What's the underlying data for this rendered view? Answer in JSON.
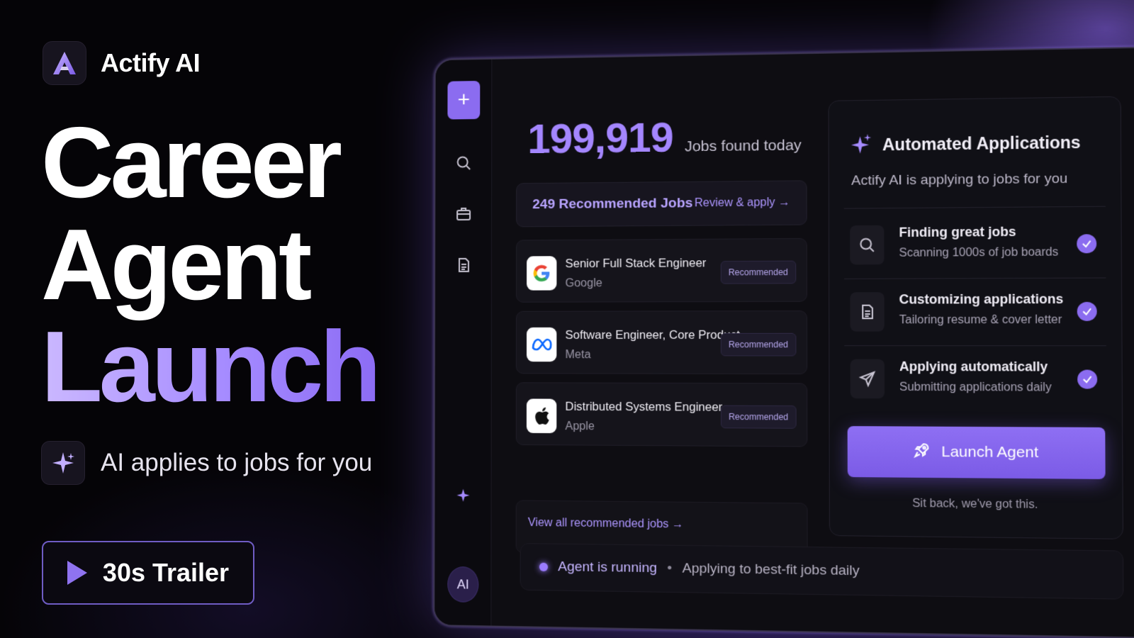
{
  "brand": {
    "name": "Actify AI",
    "logo_icon": "a-logo-icon"
  },
  "hero": {
    "line1": "Career",
    "line2": "Agent",
    "line3": "Launch",
    "tagline": "AI applies to jobs for you",
    "trailer_label": "30s Trailer"
  },
  "app": {
    "sidebar": {
      "avatar_label": "AI"
    },
    "stats": {
      "count": "199,919",
      "label": "Jobs found today"
    },
    "recommended": {
      "title": "249 Recommended Jobs",
      "link": "Review & apply →"
    },
    "jobs": [
      {
        "title": "Senior Full Stack Engineer",
        "company": "Google",
        "badge": "Recommended",
        "logo": "google-logo-icon"
      },
      {
        "title": "Software Engineer, Core Product",
        "company": "Meta",
        "badge": "Recommended",
        "logo": "meta-logo-icon"
      },
      {
        "title": "Distributed Systems Engineer",
        "company": "Apple",
        "badge": "Recommended",
        "logo": "apple-logo-icon"
      }
    ],
    "view_all": "View all recommended jobs →",
    "automation": {
      "title": "Automated Applications",
      "subtitle": "Actify AI is applying to jobs for you",
      "steps": [
        {
          "title": "Finding great jobs",
          "sub": "Scanning 1000s of job boards",
          "icon": "search-icon"
        },
        {
          "title": "Customizing applications",
          "sub": "Tailoring resume & cover letter",
          "icon": "document-icon"
        },
        {
          "title": "Applying automatically",
          "sub": "Submitting applications daily",
          "icon": "send-icon"
        }
      ],
      "launch_label": "Launch Agent",
      "footer": "Sit back, we've got this."
    },
    "status": {
      "running": "Agent is running",
      "separator": "•",
      "detail": "Applying to best-fit jobs daily"
    }
  },
  "colors": {
    "accent": "#8b6cf0",
    "accent_light": "#a486ff",
    "background": "#050407"
  }
}
